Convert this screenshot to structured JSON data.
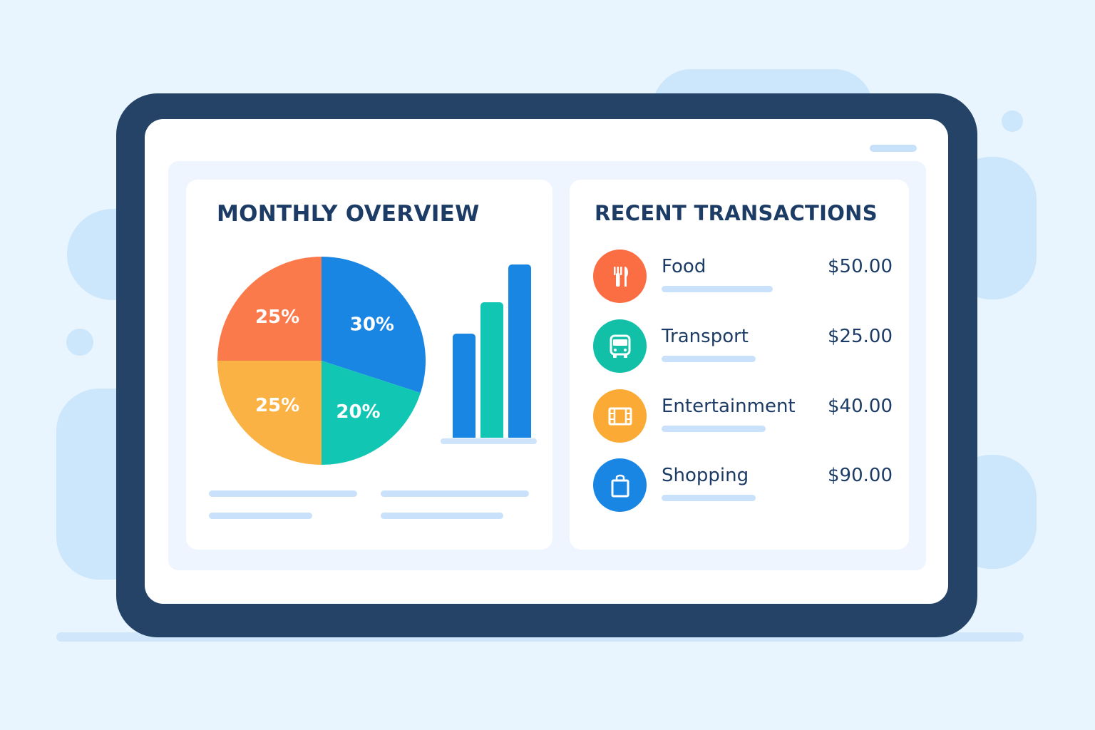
{
  "overview": {
    "title": "MONTHLY OVERVIEW",
    "pie": [
      {
        "label": "30%",
        "value": 30,
        "color": "#1a86e3"
      },
      {
        "label": "20%",
        "value": 20,
        "color": "#12c6b4"
      },
      {
        "label": "25%",
        "value": 25,
        "color": "#fbb245"
      },
      {
        "label": "25%",
        "value": 25,
        "color": "#fb7a4c"
      }
    ],
    "bars": [
      {
        "value": 0.6,
        "color": "#1a86e3"
      },
      {
        "value": 0.78,
        "color": "#12c6b4"
      },
      {
        "value": 1.0,
        "color": "#1a86e3"
      }
    ]
  },
  "transactions": {
    "title": "RECENT TRANSACTIONS",
    "items": [
      {
        "name": "Food",
        "amount": "$50.00",
        "icon": "fork-knife-icon",
        "color": "#fb6d42"
      },
      {
        "name": "Transport",
        "amount": "$25.00",
        "icon": "bus-icon",
        "color": "#12c0a8"
      },
      {
        "name": "Entertainment",
        "amount": "$40.00",
        "icon": "film-icon",
        "color": "#fbaa35"
      },
      {
        "name": "Shopping",
        "amount": "$90.00",
        "icon": "shopping-bag-icon",
        "color": "#1a86e3"
      }
    ]
  }
}
